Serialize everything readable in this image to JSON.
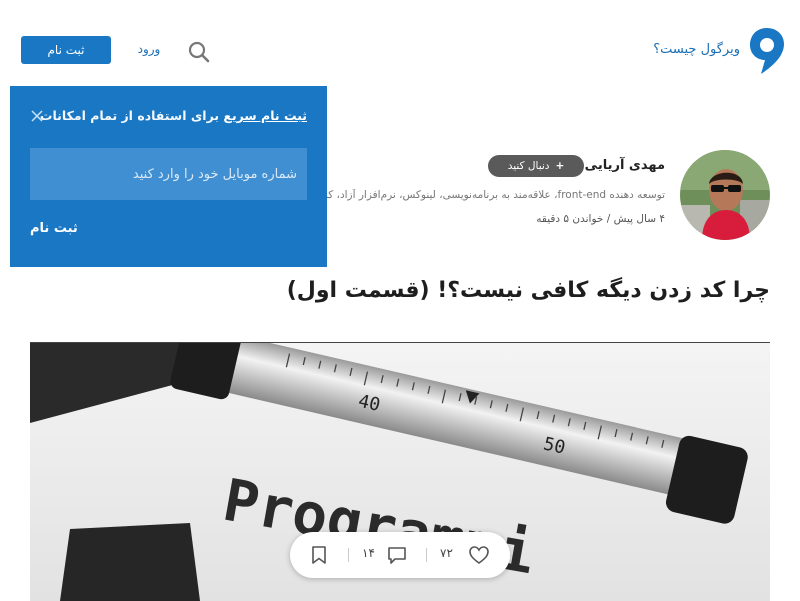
{
  "header": {
    "about_label": "ویرگول چیست؟",
    "login_label": "ورود",
    "register_label": "ثبت نام"
  },
  "popup": {
    "title_strong": "ثبت نام سریع",
    "title_rest": " برای استفاده از تمام امکانات",
    "phone_placeholder": "شماره موبایل خود را وارد کنید",
    "submit_label": "ثبت نام"
  },
  "author": {
    "name": "مهدی آریایی",
    "follow_label": "دنبال کنید",
    "follow_plus": "+",
    "bio": "توسعه دهنده front-end، علاقه‌مند به برنامه‌نویسی، لینوکس، نرم‌افزار آزاد، کت",
    "meta": "۴ سال پیش / خواندن ۵ دقیقه"
  },
  "post": {
    "title": "چرا کد زدن دیگه کافی نیست؟! (قسمت اول)",
    "hero_caption_text": "Programmi",
    "ruler_label_40": "40",
    "ruler_label_50": "50"
  },
  "actions": {
    "likes": "۷۲",
    "comments": "۱۴"
  },
  "colors": {
    "brand": "#1a77c4",
    "link": "#1a6eb3"
  }
}
